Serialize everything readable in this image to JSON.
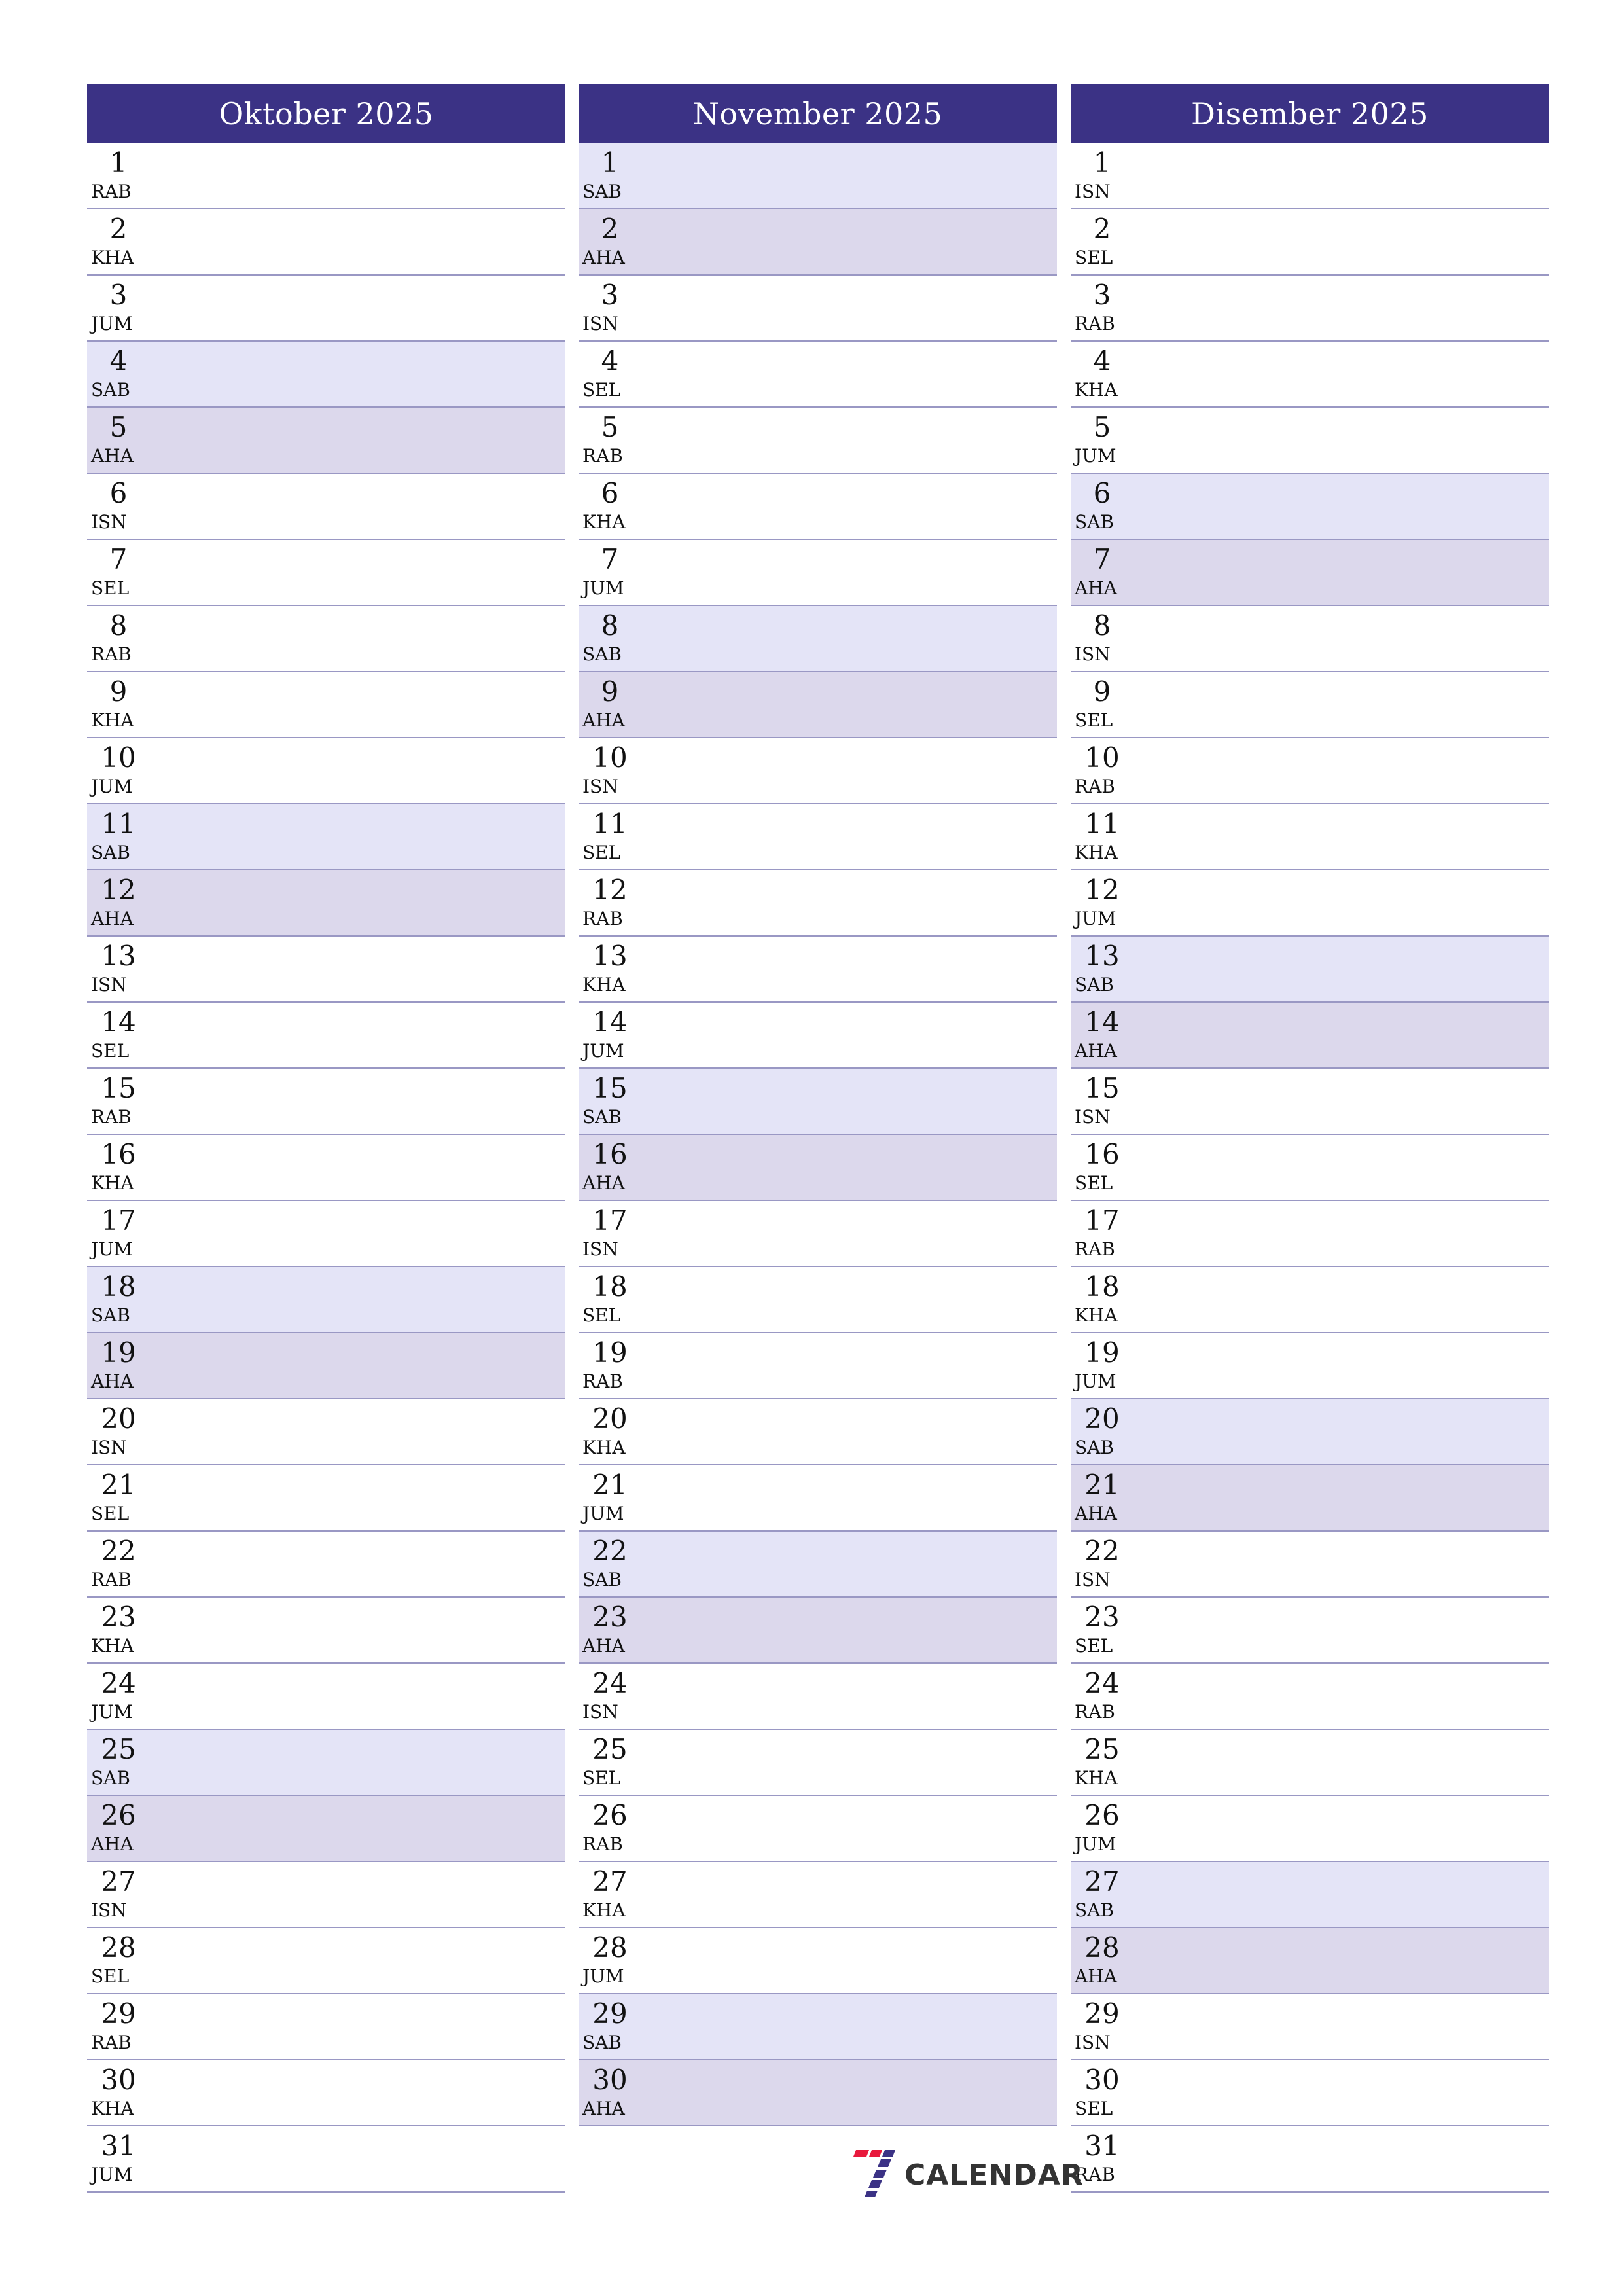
{
  "colors": {
    "header": "#3b3285",
    "saturday": "#e4e4f7",
    "sunday": "#dcd8ec",
    "separator": "#9a98c4"
  },
  "months": [
    {
      "title": "Oktober 2025",
      "days": [
        {
          "num": "1",
          "name": "RAB"
        },
        {
          "num": "2",
          "name": "KHA"
        },
        {
          "num": "3",
          "name": "JUM"
        },
        {
          "num": "4",
          "name": "SAB"
        },
        {
          "num": "5",
          "name": "AHA"
        },
        {
          "num": "6",
          "name": "ISN"
        },
        {
          "num": "7",
          "name": "SEL"
        },
        {
          "num": "8",
          "name": "RAB"
        },
        {
          "num": "9",
          "name": "KHA"
        },
        {
          "num": "10",
          "name": "JUM"
        },
        {
          "num": "11",
          "name": "SAB"
        },
        {
          "num": "12",
          "name": "AHA"
        },
        {
          "num": "13",
          "name": "ISN"
        },
        {
          "num": "14",
          "name": "SEL"
        },
        {
          "num": "15",
          "name": "RAB"
        },
        {
          "num": "16",
          "name": "KHA"
        },
        {
          "num": "17",
          "name": "JUM"
        },
        {
          "num": "18",
          "name": "SAB"
        },
        {
          "num": "19",
          "name": "AHA"
        },
        {
          "num": "20",
          "name": "ISN"
        },
        {
          "num": "21",
          "name": "SEL"
        },
        {
          "num": "22",
          "name": "RAB"
        },
        {
          "num": "23",
          "name": "KHA"
        },
        {
          "num": "24",
          "name": "JUM"
        },
        {
          "num": "25",
          "name": "SAB"
        },
        {
          "num": "26",
          "name": "AHA"
        },
        {
          "num": "27",
          "name": "ISN"
        },
        {
          "num": "28",
          "name": "SEL"
        },
        {
          "num": "29",
          "name": "RAB"
        },
        {
          "num": "30",
          "name": "KHA"
        },
        {
          "num": "31",
          "name": "JUM"
        }
      ]
    },
    {
      "title": "November 2025",
      "days": [
        {
          "num": "1",
          "name": "SAB"
        },
        {
          "num": "2",
          "name": "AHA"
        },
        {
          "num": "3",
          "name": "ISN"
        },
        {
          "num": "4",
          "name": "SEL"
        },
        {
          "num": "5",
          "name": "RAB"
        },
        {
          "num": "6",
          "name": "KHA"
        },
        {
          "num": "7",
          "name": "JUM"
        },
        {
          "num": "8",
          "name": "SAB"
        },
        {
          "num": "9",
          "name": "AHA"
        },
        {
          "num": "10",
          "name": "ISN"
        },
        {
          "num": "11",
          "name": "SEL"
        },
        {
          "num": "12",
          "name": "RAB"
        },
        {
          "num": "13",
          "name": "KHA"
        },
        {
          "num": "14",
          "name": "JUM"
        },
        {
          "num": "15",
          "name": "SAB"
        },
        {
          "num": "16",
          "name": "AHA"
        },
        {
          "num": "17",
          "name": "ISN"
        },
        {
          "num": "18",
          "name": "SEL"
        },
        {
          "num": "19",
          "name": "RAB"
        },
        {
          "num": "20",
          "name": "KHA"
        },
        {
          "num": "21",
          "name": "JUM"
        },
        {
          "num": "22",
          "name": "SAB"
        },
        {
          "num": "23",
          "name": "AHA"
        },
        {
          "num": "24",
          "name": "ISN"
        },
        {
          "num": "25",
          "name": "SEL"
        },
        {
          "num": "26",
          "name": "RAB"
        },
        {
          "num": "27",
          "name": "KHA"
        },
        {
          "num": "28",
          "name": "JUM"
        },
        {
          "num": "29",
          "name": "SAB"
        },
        {
          "num": "30",
          "name": "AHA"
        }
      ]
    },
    {
      "title": "Disember 2025",
      "days": [
        {
          "num": "1",
          "name": "ISN"
        },
        {
          "num": "2",
          "name": "SEL"
        },
        {
          "num": "3",
          "name": "RAB"
        },
        {
          "num": "4",
          "name": "KHA"
        },
        {
          "num": "5",
          "name": "JUM"
        },
        {
          "num": "6",
          "name": "SAB"
        },
        {
          "num": "7",
          "name": "AHA"
        },
        {
          "num": "8",
          "name": "ISN"
        },
        {
          "num": "9",
          "name": "SEL"
        },
        {
          "num": "10",
          "name": "RAB"
        },
        {
          "num": "11",
          "name": "KHA"
        },
        {
          "num": "12",
          "name": "JUM"
        },
        {
          "num": "13",
          "name": "SAB"
        },
        {
          "num": "14",
          "name": "AHA"
        },
        {
          "num": "15",
          "name": "ISN"
        },
        {
          "num": "16",
          "name": "SEL"
        },
        {
          "num": "17",
          "name": "RAB"
        },
        {
          "num": "18",
          "name": "KHA"
        },
        {
          "num": "19",
          "name": "JUM"
        },
        {
          "num": "20",
          "name": "SAB"
        },
        {
          "num": "21",
          "name": "AHA"
        },
        {
          "num": "22",
          "name": "ISN"
        },
        {
          "num": "23",
          "name": "SEL"
        },
        {
          "num": "24",
          "name": "RAB"
        },
        {
          "num": "25",
          "name": "KHA"
        },
        {
          "num": "26",
          "name": "JUM"
        },
        {
          "num": "27",
          "name": "SAB"
        },
        {
          "num": "28",
          "name": "AHA"
        },
        {
          "num": "29",
          "name": "ISN"
        },
        {
          "num": "30",
          "name": "SEL"
        },
        {
          "num": "31",
          "name": "RAB"
        }
      ]
    }
  ],
  "logo": {
    "icon": "seven-calendar-logo-icon",
    "text": "CALENDAR"
  }
}
